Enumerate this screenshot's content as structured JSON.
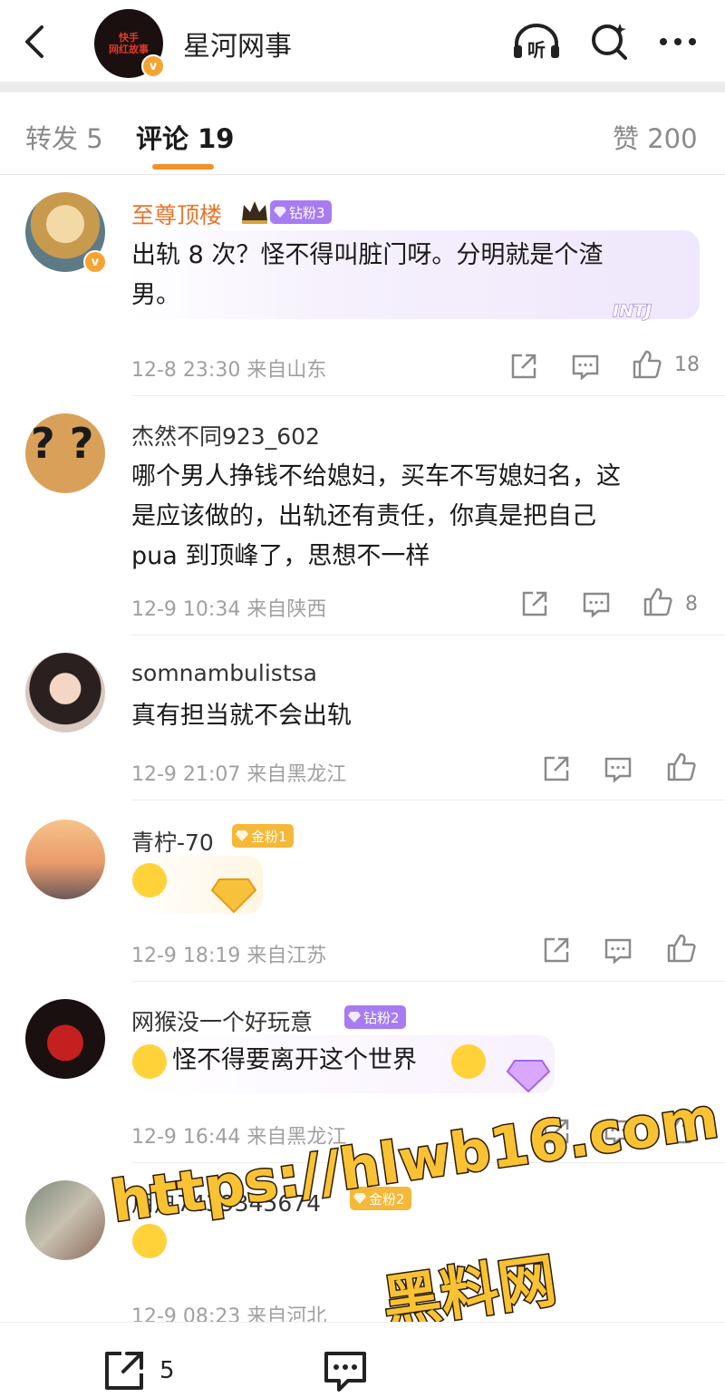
{
  "header": {
    "title": "星河网事",
    "logo_text": [
      "快手",
      "网红故事"
    ],
    "listen_label": "听"
  },
  "tabs": {
    "repost": "转发 5",
    "comments": "评论 19",
    "likes": "赞 200"
  },
  "comments": [
    {
      "username": "至尊顶楼",
      "fan_badge": "钻粉3",
      "text_line1": "出轨 8 次？怪不得叫脏门呀。分明就是个渣",
      "text_line2": "男。",
      "sticker": "INTJ",
      "time": "12-8 23:30",
      "location": "来自山东",
      "like_count": "18"
    },
    {
      "username": "杰然不同923_602",
      "text_line1": "哪个男人挣钱不给媳妇，买车不写媳妇名，这",
      "text_line2": "是应该做的，出轨还有责任，你真是把自己",
      "text_line3": "pua 到顶峰了，思想不一样",
      "time": "12-9 10:34",
      "location": "来自陕西",
      "like_count": "8"
    },
    {
      "username": "somnambulistsa",
      "text_line1": "真有担当就不会出轨",
      "time": "12-9 21:07",
      "location": "来自黑龙江"
    },
    {
      "username": "青柠-70",
      "fan_badge": "金粉1",
      "time": "12-9 18:19",
      "location": "来自江苏"
    },
    {
      "username": "网猴没一个好玩意",
      "fan_badge": "钻粉2",
      "text_line1": "怪不得要离开这个世界",
      "time": "12-9 16:44",
      "location": "来自黑龙江"
    },
    {
      "username": "用户7439345674",
      "fan_badge": "金粉2",
      "time": "12-9 08:23",
      "location": "来自河北"
    }
  ],
  "watermark": {
    "url": "https://hlwb16.com",
    "label": "黑料网"
  },
  "bottom_bar": {
    "repost_count": "5"
  },
  "colors": {
    "accent_orange": "#f5902a",
    "vip_name": "#e8742a",
    "diamond_fan": "#a77cf2",
    "gold_fan": "#f6b838",
    "meta_gray": "#a0a0a0"
  }
}
